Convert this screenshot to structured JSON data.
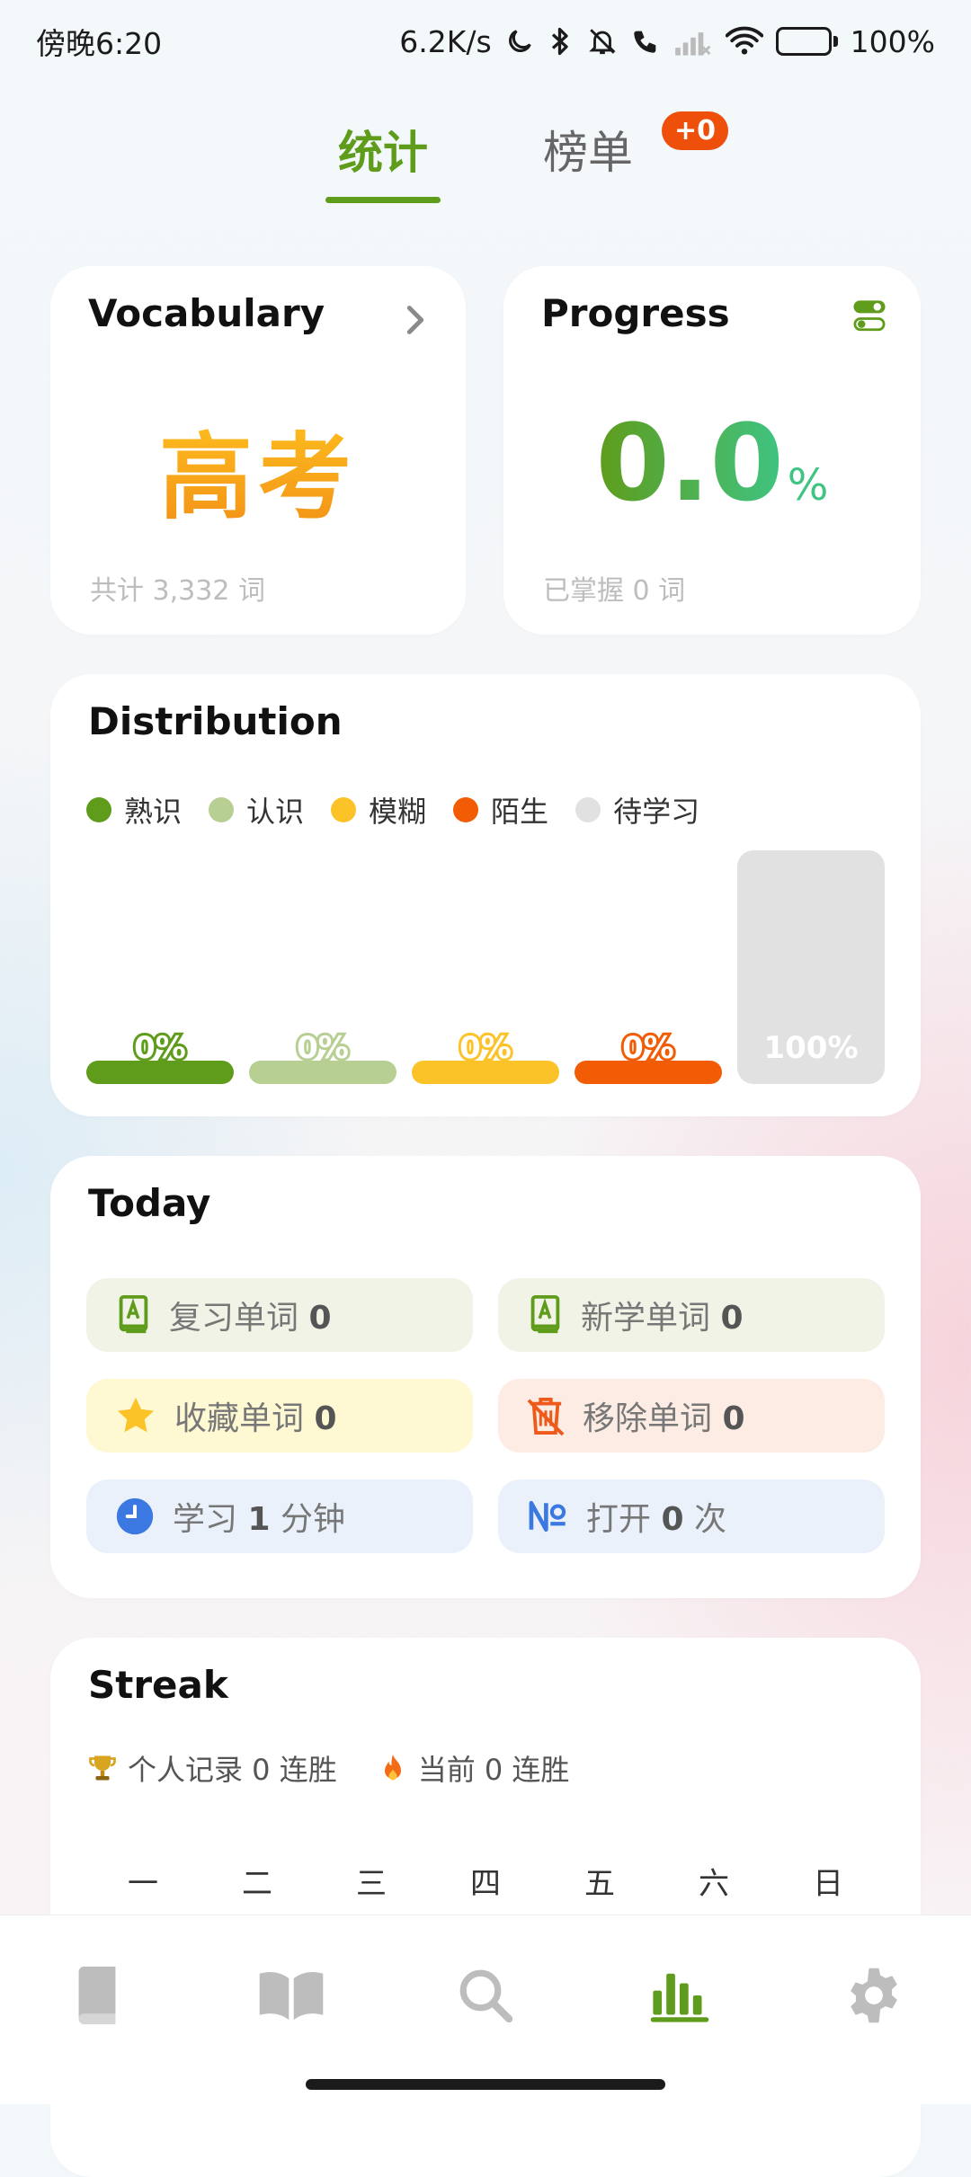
{
  "status_bar": {
    "time": "傍晚6:20",
    "net_speed": "6.2K/s",
    "battery": "100%",
    "battery_level": 1.0
  },
  "tabs": [
    {
      "label": "统计",
      "active": true
    },
    {
      "label": "榜单",
      "active": false,
      "badge": "+0"
    }
  ],
  "vocabulary": {
    "title": "Vocabulary",
    "book": "高考",
    "total": "共计 3,332 词"
  },
  "progress": {
    "title": "Progress",
    "value": "0.0",
    "unit": "%",
    "mastered": "已掌握 0 词"
  },
  "distribution": {
    "title": "Distribution",
    "legend": [
      {
        "label": "熟识",
        "color": "#5f9c1b"
      },
      {
        "label": "认识",
        "color": "#b7cf93"
      },
      {
        "label": "模糊",
        "color": "#fcc329"
      },
      {
        "label": "陌生",
        "color": "#f25c05"
      },
      {
        "label": "待学习",
        "color": "#e1e1e1"
      }
    ],
    "bars": [
      {
        "label": "0%",
        "value": 0
      },
      {
        "label": "0%",
        "value": 0
      },
      {
        "label": "0%",
        "value": 0
      },
      {
        "label": "0%",
        "value": 0
      },
      {
        "label": "100%",
        "value": 100
      }
    ]
  },
  "today": {
    "title": "Today",
    "items": [
      {
        "prefix": "复习单词",
        "value": "0",
        "suffix": "",
        "icon": "book-a-icon"
      },
      {
        "prefix": "新学单词",
        "value": "0",
        "suffix": "",
        "icon": "book-a-icon"
      },
      {
        "prefix": "收藏单词",
        "value": "0",
        "suffix": "",
        "icon": "star-icon"
      },
      {
        "prefix": "移除单词",
        "value": "0",
        "suffix": "",
        "icon": "trash-icon"
      },
      {
        "prefix": "学习",
        "value": "1",
        "suffix": "分钟",
        "icon": "clock-icon"
      },
      {
        "prefix": "打开",
        "value": "0",
        "suffix": "次",
        "icon": "numero-icon"
      }
    ]
  },
  "streak": {
    "title": "Streak",
    "record": "个人记录 0 连胜",
    "current": "当前 0 连胜",
    "weekdays": [
      "一",
      "二",
      "三",
      "四",
      "五",
      "六",
      "日"
    ]
  },
  "nav": [
    {
      "icon": "book-icon",
      "active": false
    },
    {
      "icon": "open-book-icon",
      "active": false
    },
    {
      "icon": "search-icon",
      "active": false
    },
    {
      "icon": "bar-chart-icon",
      "active": true
    },
    {
      "icon": "gear-icon",
      "active": false
    }
  ]
}
